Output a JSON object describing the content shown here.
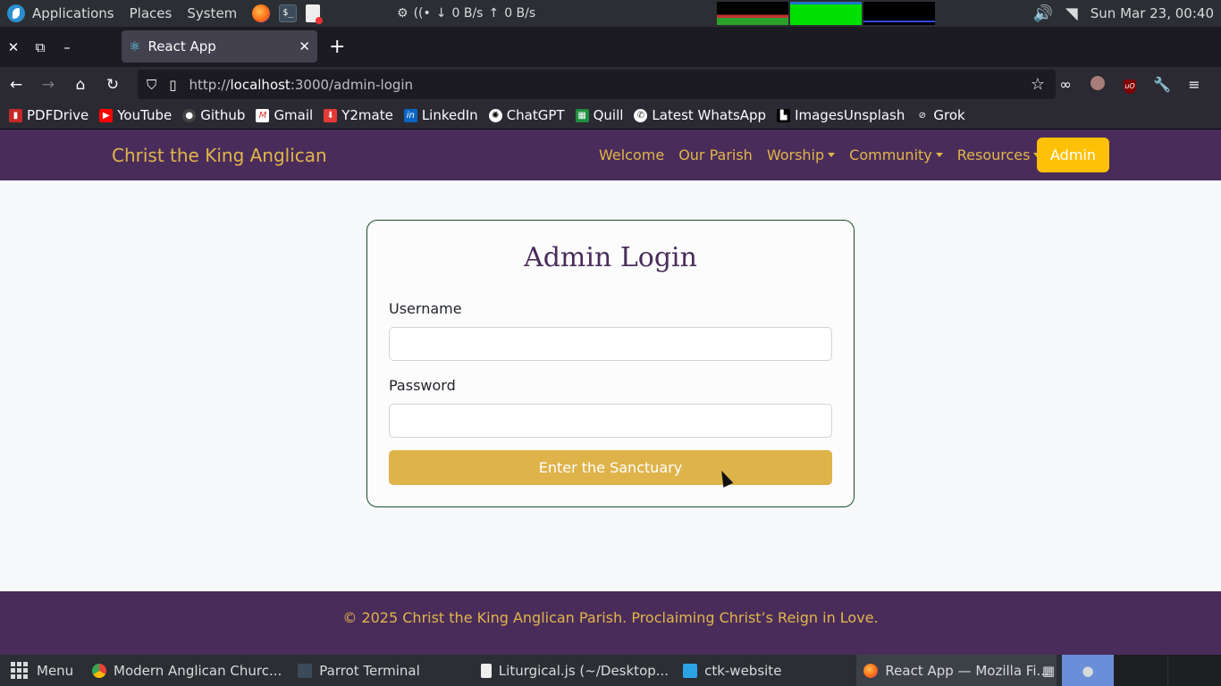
{
  "system_panel": {
    "menus": [
      "Applications",
      "Places",
      "System"
    ],
    "net_down": "0 B/s",
    "net_up": "0 B/s",
    "clock": "Sun Mar 23, 00:40"
  },
  "browser": {
    "tab_title": "React App",
    "url_prefix": "http://",
    "url_host": "localhost",
    "url_path": ":3000/admin-login"
  },
  "bookmarks": [
    "PDFDrive",
    "YouTube",
    "Github",
    "Gmail",
    "Y2mate",
    "LinkedIn",
    "ChatGPT",
    "Quill",
    "Latest WhatsApp",
    "ImagesUnsplash",
    "Grok"
  ],
  "site": {
    "brand": "Christ the King Anglican",
    "nav": {
      "welcome": "Welcome",
      "parish": "Our Parish",
      "worship": "Worship",
      "community": "Community",
      "resources": "Resources",
      "admin": "Admin"
    },
    "login": {
      "title": "Admin Login",
      "username_label": "Username",
      "username_value": "",
      "password_label": "Password",
      "password_value": "",
      "submit": "Enter the Sanctuary"
    },
    "footer": "© 2025 Christ the King Anglican Parish. Proclaiming Christ’s Reign in Love."
  },
  "taskbar": {
    "menu": "Menu",
    "items": [
      "Modern Anglican Churc...",
      "Parrot Terminal",
      "Liturgical.js (~/Desktop...",
      "ctk-website",
      "React App — Mozilla Fi..."
    ]
  },
  "colors": {
    "brand_purple": "#4a2c5a",
    "brand_gold": "#e0b64a",
    "admin_button": "#ffc107",
    "submit_button": "#deb34a",
    "card_border": "#1e4d2b"
  }
}
